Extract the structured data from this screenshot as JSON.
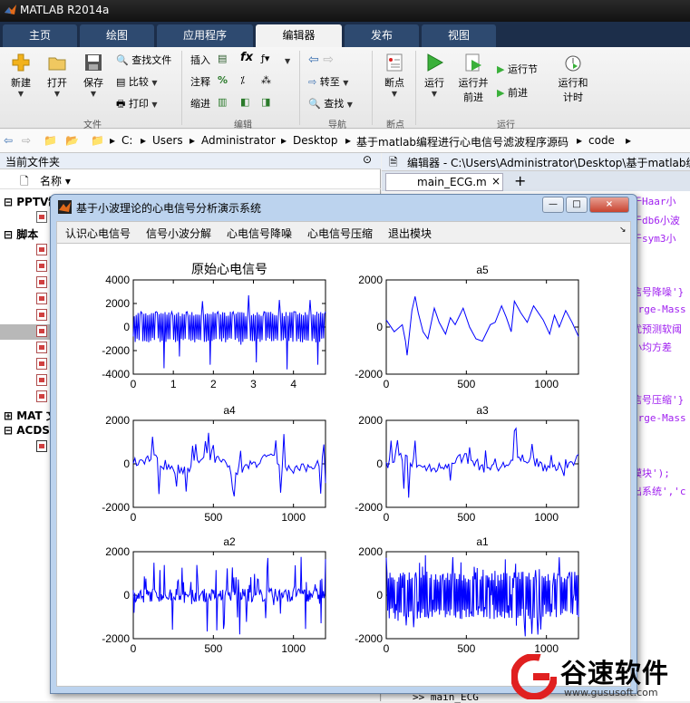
{
  "app": {
    "title": "MATLAB R2014a"
  },
  "ribbon_tabs": [
    "主页",
    "绘图",
    "应用程序",
    "编辑器",
    "发布",
    "视图"
  ],
  "active_tab": "编辑器",
  "ribbon": {
    "file_group": {
      "label": "文件",
      "new": "新建",
      "open": "打开",
      "save": "保存",
      "find_files": "查找文件",
      "compare": "比较",
      "print": "打印"
    },
    "edit_group": {
      "label": "编辑",
      "insert": "插入",
      "comment": "注释",
      "indent": "缩进",
      "fx": "fx"
    },
    "nav_group": {
      "label": "导航",
      "goto": "转至",
      "find": "查找"
    },
    "breakpoint_group": {
      "label": "断点",
      "breakpoints": "断点"
    },
    "run_group": {
      "label": "运行",
      "run": "运行",
      "run_advance_1": "运行并",
      "run_advance_2": "前进",
      "run_section": "运行节",
      "advance": "前进",
      "run_time_1": "运行和",
      "run_time_2": "计时"
    }
  },
  "address": {
    "path": [
      "C:",
      "Users",
      "Administrator",
      "Desktop",
      "基于matlab编程进行心电信号滤波程序源码",
      "code"
    ]
  },
  "current_folder": {
    "title": "当前文件夹",
    "name_col": "名称 ▾",
    "groups": [
      "PPTV制",
      "脚本",
      "MAT 文",
      "ACDS"
    ]
  },
  "editor": {
    "title": "编辑器 - C:\\Users\\Administrator\\Desktop\\基于matlab编",
    "tab": "main_ECG.m",
    "tab_close": "×",
    "add_tab": "+",
    "code_lines": [
      {
        "text": "于Haar小",
        "color": "purple"
      },
      {
        "text": "于db6小波",
        "color": "purple"
      },
      {
        "text": "于sym3小",
        "color": "purple"
      },
      {
        "text": "信号降噪'}",
        "color": "purple"
      },
      {
        "text": "irge-Mass",
        "color": "purple"
      },
      {
        "text": "优预测软阈",
        "color": "purple"
      },
      {
        "text": "小均方差",
        "color": "purple"
      },
      {
        "text": "信号压缩'}",
        "color": "purple"
      },
      {
        "text": "irge-Mass",
        "color": "purple"
      },
      {
        "text": "模块');",
        "color": "purple"
      },
      {
        "text": "出系统','c",
        "color": "purple"
      }
    ],
    "command_line": ">> main_ECG"
  },
  "figure": {
    "title": "基于小波理论的心电信号分析演示系统",
    "menu": [
      "认识心电信号",
      "信号小波分解",
      "心电信号降噪",
      "心电信号压缩",
      "退出模块"
    ],
    "controls": {
      "minimize": "—",
      "maximize": "□",
      "close": "×"
    }
  },
  "chart_data": [
    {
      "type": "line",
      "title": "原始心电信号",
      "xlim": [
        0,
        4.8
      ],
      "ylim": [
        -4000,
        4000
      ],
      "xticks": [
        0,
        1,
        2,
        3,
        4
      ],
      "yticks": [
        4000,
        2000,
        0,
        -2000,
        -4000
      ],
      "series": [
        {
          "color": "#0000ff",
          "style": "dense-noisy",
          "amplitude": 1300,
          "y": [
            -800,
            1300,
            -1300,
            1300,
            -3500,
            1300,
            -2500,
            1300,
            -1300,
            2200,
            -3200,
            1300,
            -1300,
            1300,
            -1500,
            2700,
            -3000,
            1300,
            -1200,
            2300,
            -3600,
            1300,
            -1300,
            2300,
            -3200,
            1300
          ]
        }
      ]
    },
    {
      "type": "line",
      "title": "a5",
      "xlim": [
        0,
        1200
      ],
      "ylim": [
        -2000,
        2000
      ],
      "xticks": [
        0,
        500,
        1000
      ],
      "yticks": [
        2000,
        0,
        -2000
      ],
      "series": [
        {
          "color": "#0000ff",
          "x": [
            0,
            50,
            100,
            120,
            130,
            160,
            180,
            200,
            230,
            260,
            300,
            330,
            370,
            400,
            430,
            480,
            520,
            560,
            600,
            650,
            680,
            720,
            750,
            780,
            800,
            840,
            880,
            920,
            980,
            1020,
            1050,
            1080,
            1120,
            1160,
            1200
          ],
          "y": [
            300,
            -200,
            100,
            -600,
            -1200,
            700,
            1300,
            600,
            -200,
            -500,
            800,
            200,
            -300,
            400,
            100,
            800,
            0,
            -500,
            -600,
            100,
            200,
            900,
            400,
            -200,
            1100,
            600,
            200,
            900,
            300,
            -300,
            500,
            0,
            700,
            200,
            -400
          ]
        }
      ]
    },
    {
      "type": "line",
      "title": "a4",
      "xlim": [
        0,
        1200
      ],
      "ylim": [
        -2000,
        2000
      ],
      "xticks": [
        0,
        500,
        1000
      ],
      "yticks": [
        2000,
        0,
        -2000
      ],
      "series": [
        {
          "color": "#0000ff",
          "style": "wavy",
          "amplitude": 1500
        }
      ]
    },
    {
      "type": "line",
      "title": "a3",
      "xlim": [
        0,
        1200
      ],
      "ylim": [
        -2000,
        2000
      ],
      "xticks": [
        0,
        500,
        1000
      ],
      "yticks": [
        2000,
        0,
        -2000
      ],
      "series": [
        {
          "color": "#0000ff",
          "style": "wavy",
          "amplitude": 1700
        }
      ]
    },
    {
      "type": "line",
      "title": "a2",
      "xlim": [
        0,
        1200
      ],
      "ylim": [
        -2000,
        2000
      ],
      "xticks": [
        0,
        500,
        1000
      ],
      "yticks": [
        2000,
        0,
        -2000
      ],
      "series": [
        {
          "color": "#0000ff",
          "style": "noisy",
          "amplitude": 1800
        }
      ]
    },
    {
      "type": "line",
      "title": "a1",
      "xlim": [
        0,
        1200
      ],
      "ylim": [
        -2000,
        2000
      ],
      "xticks": [
        0,
        500,
        1000
      ],
      "yticks": [
        2000,
        0,
        -2000
      ],
      "series": [
        {
          "color": "#0000ff",
          "style": "dense-noisy",
          "amplitude": 1900
        }
      ]
    }
  ],
  "watermark": {
    "brand": "谷速软件",
    "url": "www.gususoft.com"
  }
}
